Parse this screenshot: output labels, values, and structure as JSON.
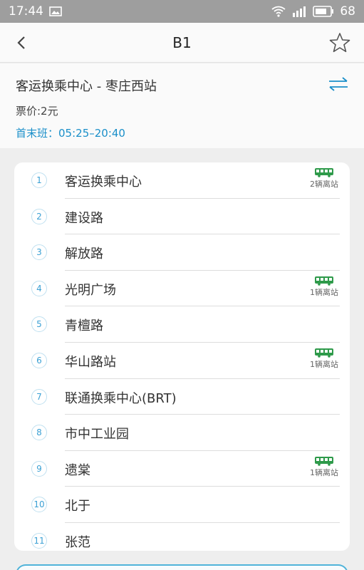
{
  "status_bar": {
    "time": "17:44",
    "battery": "68"
  },
  "nav": {
    "title": "B1"
  },
  "route": {
    "name": "客运换乘中心 - 枣庄西站",
    "fare": "票价:2元",
    "schedule_label": "首末班：",
    "schedule_time": "05:25–20:40"
  },
  "colors": {
    "accent": "#1a8fc9",
    "bus_green": "#2e9a4a",
    "stop_num": "#3aa0d4"
  },
  "stops": [
    {
      "num": "1",
      "name": "客运换乘中心",
      "bus": "2辆离站"
    },
    {
      "num": "2",
      "name": "建设路",
      "bus": ""
    },
    {
      "num": "3",
      "name": "解放路",
      "bus": ""
    },
    {
      "num": "4",
      "name": "光明广场",
      "bus": "1辆离站"
    },
    {
      "num": "5",
      "name": "青檀路",
      "bus": ""
    },
    {
      "num": "6",
      "name": "华山路站",
      "bus": "1辆离站"
    },
    {
      "num": "7",
      "name": "联通换乘中心(BRT)",
      "bus": ""
    },
    {
      "num": "8",
      "name": "市中工业园",
      "bus": ""
    },
    {
      "num": "9",
      "name": "遗棠",
      "bus": "1辆离站"
    },
    {
      "num": "10",
      "name": "北于",
      "bus": ""
    },
    {
      "num": "11",
      "name": "张范",
      "bus": ""
    }
  ]
}
